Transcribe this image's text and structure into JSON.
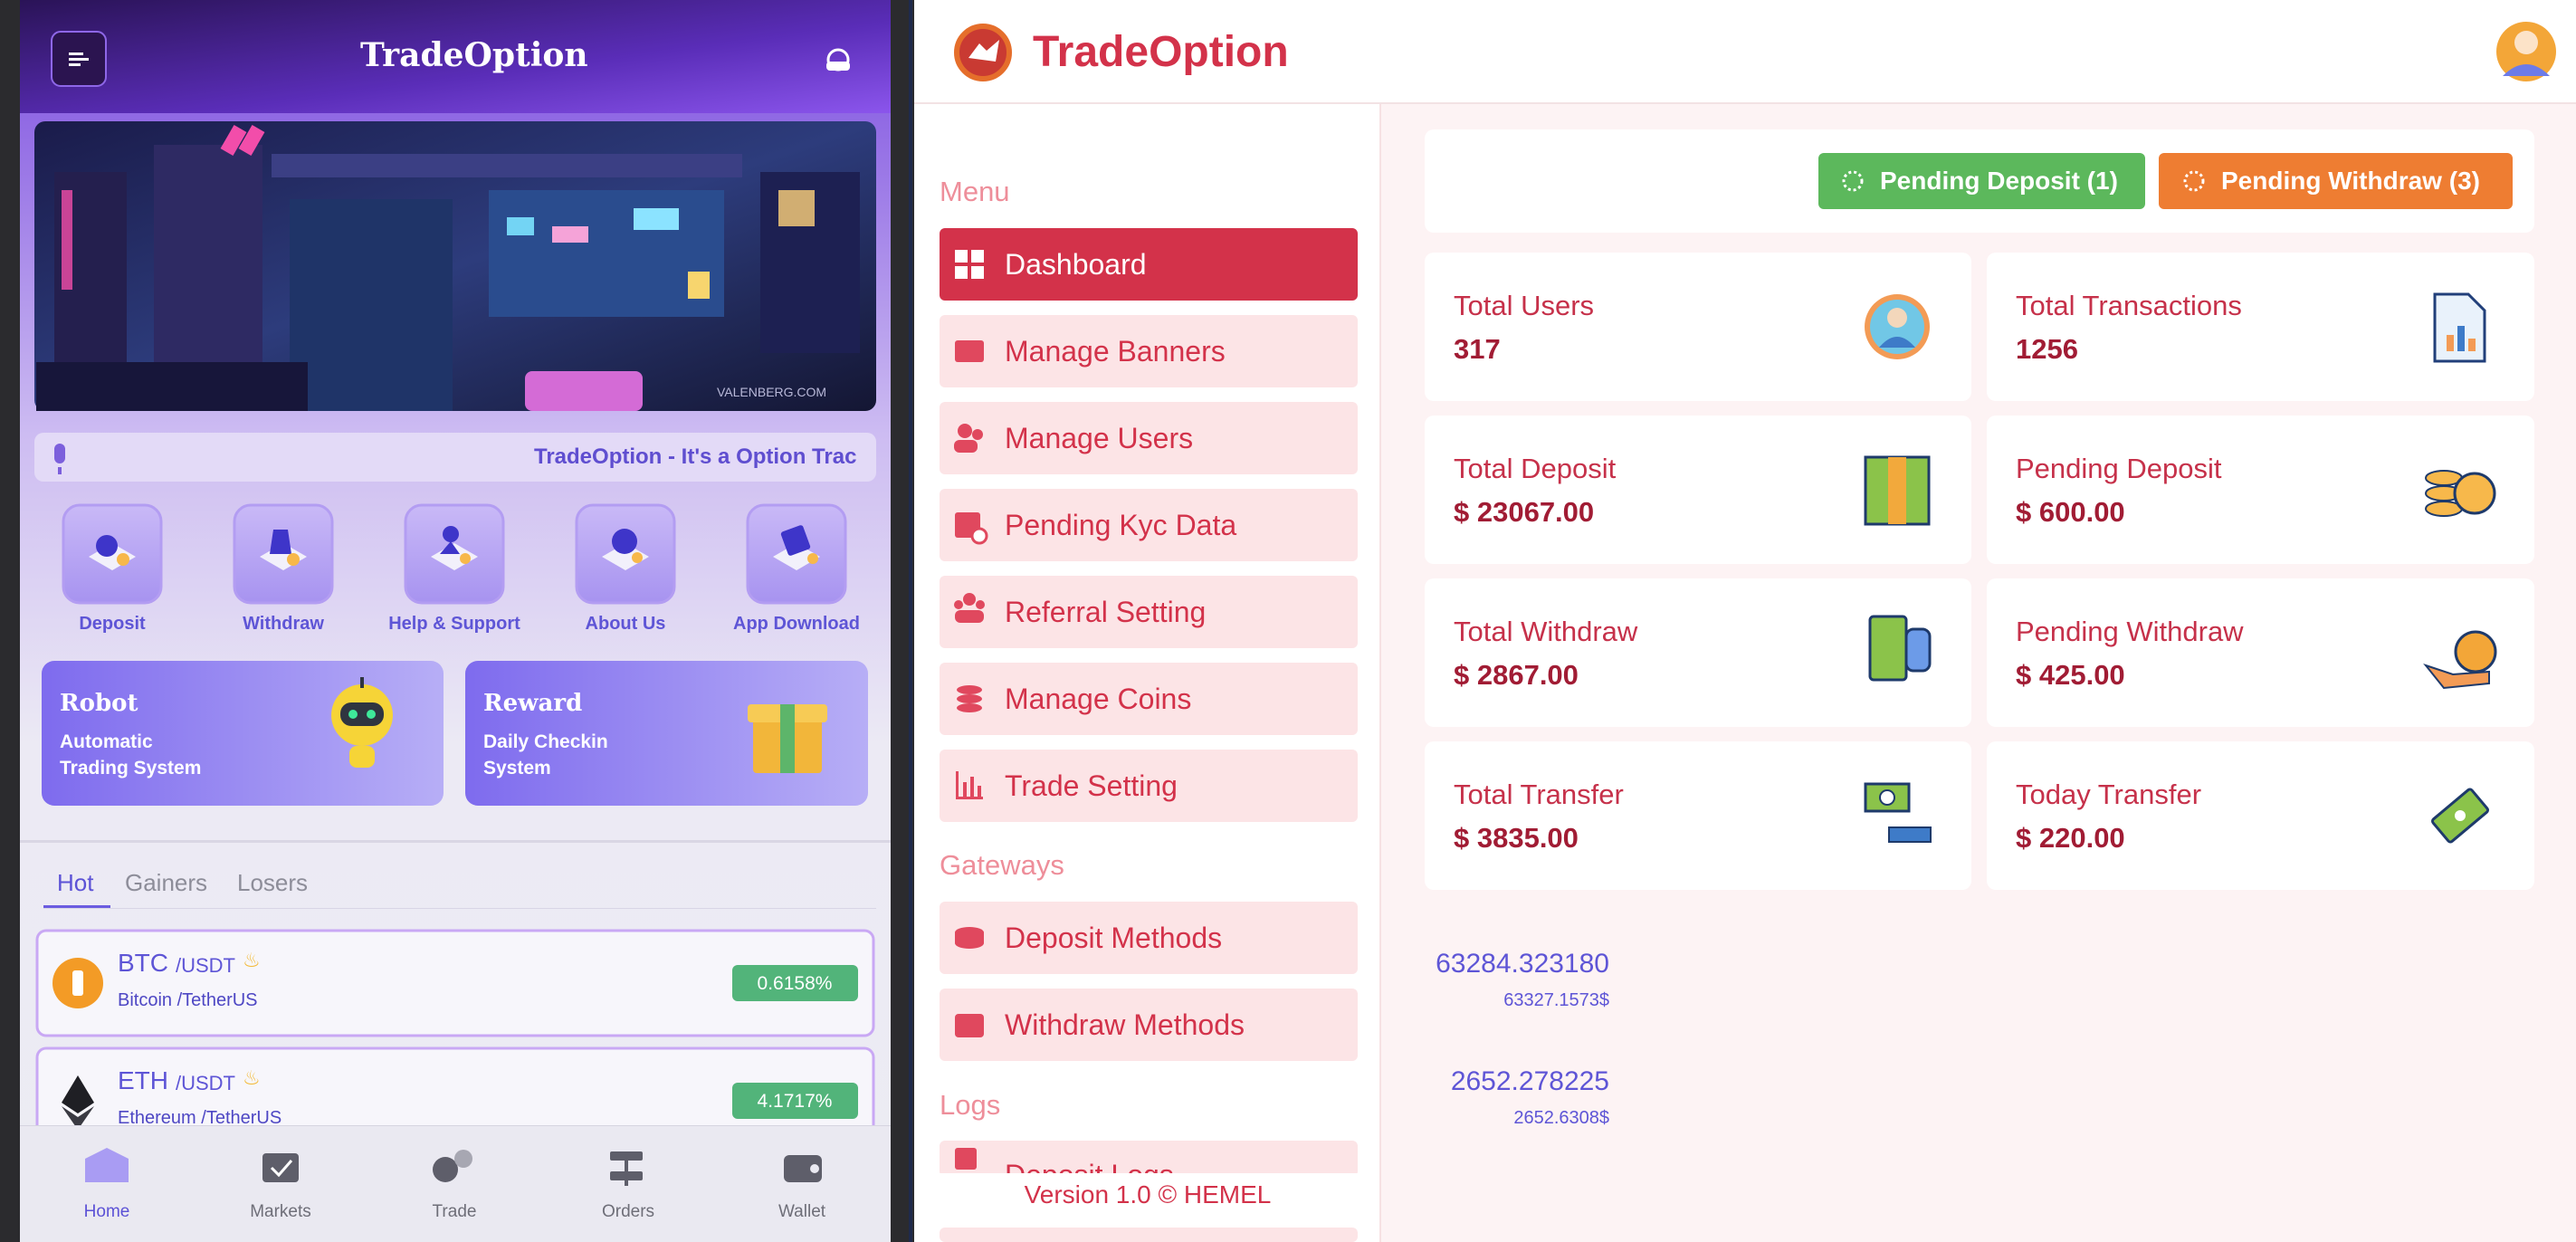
{
  "app": {
    "mobile_title": "TradeOption",
    "banner_watermark": "VALENBERG.COM",
    "marquee_text": "TradeOption - It's a Option Trac",
    "quick_actions": [
      {
        "label": "Deposit",
        "icon": "deposit-icon"
      },
      {
        "label": "Withdraw",
        "icon": "withdraw-icon"
      },
      {
        "label": "Help & Support",
        "icon": "help-support-icon"
      },
      {
        "label": "About Us",
        "icon": "about-us-icon"
      },
      {
        "label": "App Download",
        "icon": "app-download-icon"
      }
    ],
    "promo_cards": [
      {
        "title": "Robot",
        "line1": "Automatic",
        "line2": "Trading System",
        "icon": "robot-icon"
      },
      {
        "title": "Reward",
        "line1": "Daily Checkin",
        "line2": "System",
        "icon": "gift-icon"
      }
    ],
    "market_tabs": [
      {
        "label": "Hot",
        "active": true
      },
      {
        "label": "Gainers",
        "active": false
      },
      {
        "label": "Losers",
        "active": false
      }
    ],
    "market_rows": [
      {
        "symbol": "BTC",
        "pair": "/USDT",
        "name": "Bitcoin /TetherUS",
        "price": "63284.323180",
        "usd": "63327.1573$",
        "change": "0.6158%",
        "icon": "bitcoin-icon"
      },
      {
        "symbol": "ETH",
        "pair": "/USDT",
        "name": "Ethereum /TetherUS",
        "price": "2652.278225",
        "usd": "2652.6308$",
        "change": "4.1717%",
        "icon": "ethereum-icon"
      }
    ],
    "bottom_nav": [
      {
        "label": "Home",
        "icon": "home-icon",
        "active": true
      },
      {
        "label": "Markets",
        "icon": "markets-icon",
        "active": false
      },
      {
        "label": "Trade",
        "icon": "trade-icon",
        "active": false
      },
      {
        "label": "Orders",
        "icon": "orders-icon",
        "active": false
      },
      {
        "label": "Wallet",
        "icon": "wallet-icon",
        "active": false
      }
    ]
  },
  "admin": {
    "brand": "TradeOption",
    "sections": {
      "menu": "Menu",
      "gateways": "Gateways",
      "logs": "Logs"
    },
    "menu_items": [
      {
        "label": "Dashboard",
        "icon": "dashboard-icon",
        "active": true
      },
      {
        "label": "Manage Banners",
        "icon": "ad-icon",
        "active": false
      },
      {
        "label": "Manage Users",
        "icon": "users-icon",
        "active": false
      },
      {
        "label": "Pending Kyc Data",
        "icon": "kyc-icon",
        "active": false
      },
      {
        "label": "Referral Setting",
        "icon": "referral-icon",
        "active": false
      },
      {
        "label": "Manage Coins",
        "icon": "coins-icon",
        "active": false
      },
      {
        "label": "Trade Setting",
        "icon": "chart-icon",
        "active": false
      }
    ],
    "gateway_items": [
      {
        "label": "Deposit Methods",
        "icon": "deposit-methods-icon"
      },
      {
        "label": "Withdraw Methods",
        "icon": "withdraw-methods-icon"
      }
    ],
    "logs_items": [
      {
        "label": "Deposit Logs",
        "icon": "deposit-logs-icon"
      }
    ],
    "version": "Version 1.0 © HEMEL",
    "pending_buttons": [
      {
        "label": "Pending Deposit (1)",
        "color": "#5CB85C"
      },
      {
        "label": "Pending Withdraw (3)",
        "color": "#EE7D32"
      }
    ],
    "stats": [
      {
        "label": "Total Users",
        "value": "317",
        "icon": "user-avatar-icon"
      },
      {
        "label": "Total Transactions",
        "value": "1256",
        "icon": "report-icon"
      },
      {
        "label": "Total Deposit",
        "value": "$ 23067.00",
        "icon": "cash-bundle-icon"
      },
      {
        "label": "Pending Deposit",
        "value": "$ 600.00",
        "icon": "coin-stack-icon"
      },
      {
        "label": "Total Withdraw",
        "value": "$ 2867.00",
        "icon": "hand-cash-icon"
      },
      {
        "label": "Pending Withdraw",
        "value": "$ 425.00",
        "icon": "money-bag-hand-icon"
      },
      {
        "label": "Total Transfer",
        "value": "$ 3835.00",
        "icon": "transfer-icon"
      },
      {
        "label": "Today Transfer",
        "value": "$ 220.00",
        "icon": "flying-money-icon"
      }
    ]
  },
  "colors": {
    "accent": "#D3324A",
    "sidebar_item_bg": "#FCE4E6",
    "page_bg": "#FDF3F4",
    "mobile_purple": "#7D55E6",
    "change_green": "#52B47A"
  }
}
